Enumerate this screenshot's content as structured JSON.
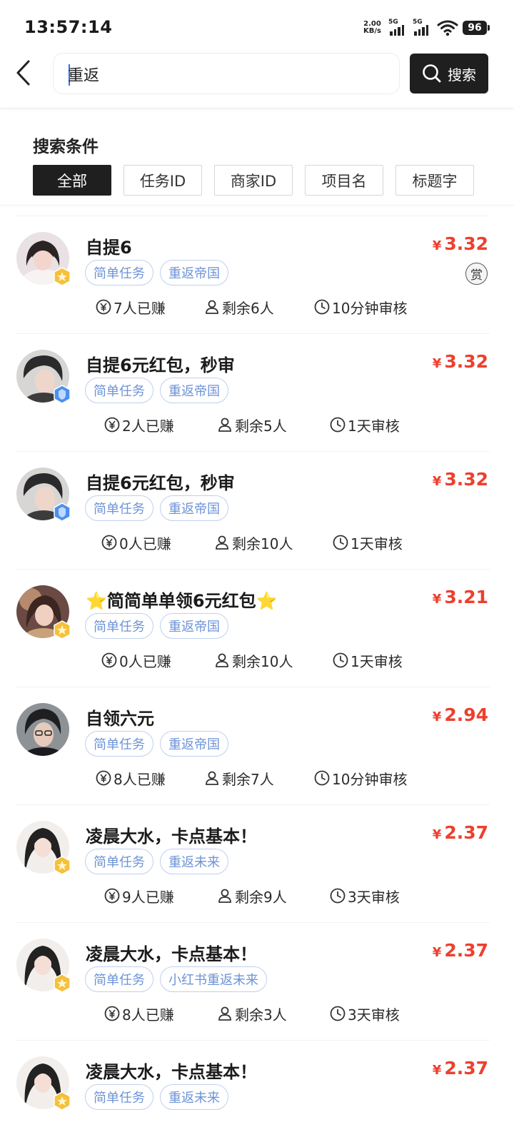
{
  "status_bar": {
    "time": "13:57:14",
    "net_speed_value": "2.00",
    "net_speed_unit": "KB/s",
    "signal_1_label": "5G",
    "signal_2_label": "5G",
    "battery": "96"
  },
  "header": {
    "back_icon": "back-arrow-icon",
    "search_value": "重返",
    "search_button_label": "搜索"
  },
  "filter": {
    "title": "搜索条件",
    "chips": [
      {
        "label": "全部",
        "active": true
      },
      {
        "label": "任务ID",
        "active": false
      },
      {
        "label": "商家ID",
        "active": false
      },
      {
        "label": "项目名",
        "active": false
      },
      {
        "label": "标题字",
        "active": false
      }
    ]
  },
  "currency_symbol": "¥",
  "tasks": [
    {
      "title": "自提6",
      "price": "3.32",
      "tags": [
        "简单任务",
        "重返帝国"
      ],
      "earned": "7人已赚",
      "remaining": "剩余6人",
      "review": "10分钟审核",
      "reward_badge": "赏",
      "avatar_badge": "gold-medal-icon"
    },
    {
      "title": "自提6元红包，秒审",
      "price": "3.32",
      "tags": [
        "简单任务",
        "重返帝国"
      ],
      "earned": "2人已赚",
      "remaining": "剩余5人",
      "review": "1天审核",
      "avatar_badge": "blue-shield-icon"
    },
    {
      "title": "自提6元红包，秒审",
      "price": "3.32",
      "tags": [
        "简单任务",
        "重返帝国"
      ],
      "earned": "0人已赚",
      "remaining": "剩余10人",
      "review": "1天审核",
      "avatar_badge": "blue-shield-icon"
    },
    {
      "title_prefix": "⭐",
      "title": "简简单单领6元红包",
      "title_suffix": "⭐",
      "price": "3.21",
      "tags": [
        "简单任务",
        "重返帝国"
      ],
      "earned": "0人已赚",
      "remaining": "剩余10人",
      "review": "1天审核",
      "avatar_badge": "gold-medal-icon"
    },
    {
      "title": "自领六元",
      "price": "2.94",
      "tags": [
        "简单任务",
        "重返帝国"
      ],
      "earned": "8人已赚",
      "remaining": "剩余7人",
      "review": "10分钟审核"
    },
    {
      "title": "凌晨大水，卡点基本！",
      "price": "2.37",
      "tags": [
        "简单任务",
        "重返未来"
      ],
      "earned": "9人已赚",
      "remaining": "剩余9人",
      "review": "3天审核",
      "avatar_badge": "gold-medal-icon"
    },
    {
      "title": "凌晨大水，卡点基本！",
      "price": "2.37",
      "tags": [
        "简单任务",
        "小红书重返未来"
      ],
      "earned": "8人已赚",
      "remaining": "剩余3人",
      "review": "3天审核",
      "avatar_badge": "gold-medal-icon"
    },
    {
      "title": "凌晨大水，卡点基本！",
      "price": "2.37",
      "tags": [
        "简单任务",
        "重返未来"
      ],
      "avatar_badge": "gold-medal-icon"
    }
  ],
  "icons": {
    "earned": "yen-coin-icon",
    "remaining": "user-icon",
    "review": "clock-icon"
  },
  "colors": {
    "price": "#ee3f2e",
    "tag_text": "#6d93d6",
    "tag_border": "#bfd0ef",
    "active_chip": "#1f1f1f"
  }
}
